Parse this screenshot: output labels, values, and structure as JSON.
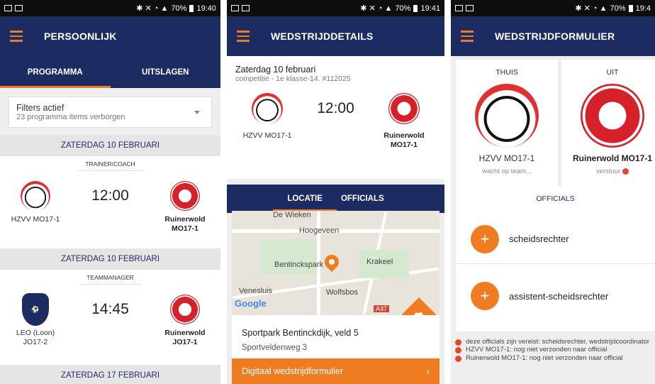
{
  "status": {
    "p1": {
      "battery": "70%",
      "time": "19:40"
    },
    "p2": {
      "battery": "70%",
      "time": "19:41"
    },
    "p3": {
      "battery": "70%",
      "time": "19:4"
    }
  },
  "colors": {
    "navy": "#1d2b63",
    "orange": "#f07c22"
  },
  "screen1": {
    "title": "PERSOONLIJK",
    "tabs": [
      "PROGRAMMA",
      "UITSLAGEN"
    ],
    "filters": {
      "title": "Filters actief",
      "subtitle": "23 programma items verborgen"
    },
    "matches": [
      {
        "date": "ZATERDAG 10 FEBRUARI",
        "role": "TRAINER/COACH",
        "time": "12:00",
        "home": "HZVV MO17-1",
        "away": "Ruinerwold MO17-1"
      },
      {
        "date": "ZATERDAG 10 FEBRUARI",
        "role": "TEAMMANAGER",
        "time": "14:45",
        "home": "LEO (Loon) JO17-2",
        "away": "Ruinerwold JO17-1"
      }
    ],
    "next_date": "ZATERDAG 17 FEBRUARI"
  },
  "screen2": {
    "title": "WEDSTRIJDDETAILS",
    "date": "Zaterdag 10 februari",
    "meta": "competitie - 1e klasse-14. #112025",
    "time": "12:00",
    "home": "HZVV MO17-1",
    "away": "Ruinerwold MO17-1",
    "tabs": [
      "LOCATIE",
      "OFFICIALS"
    ],
    "map_labels": [
      "De Wieken",
      "Hoogeveen",
      "Bentinckspark",
      "Krakeel",
      "Venesluis",
      "Wolfsbos",
      "Google",
      "A37"
    ],
    "venue": "Sportpark Bentinckdijk, veld 5",
    "address": "Sportveldenweg 3",
    "button": "Digitaal wedstrijdformulier"
  },
  "screen3": {
    "title": "WEDSTRIJDFORMULIER",
    "home_label": "THUIS",
    "away_label": "UIT",
    "home": "HZVV MO17-1",
    "home_status": "wacht op team...",
    "away": "Ruinerwold MO17-1",
    "away_status": "verstuur",
    "officials_header": "OFFICIALS",
    "officials": [
      "scheidsrechter",
      "assistent-scheidsrechter"
    ],
    "notes": [
      "deze officials zijn vereist: scheidsrechter, wedstrijdcoordinator",
      "HZVV MO17-1: nog niet verzonden naar official",
      "Ruinerwold MO17-1: nog niet verzonden naar official"
    ]
  }
}
